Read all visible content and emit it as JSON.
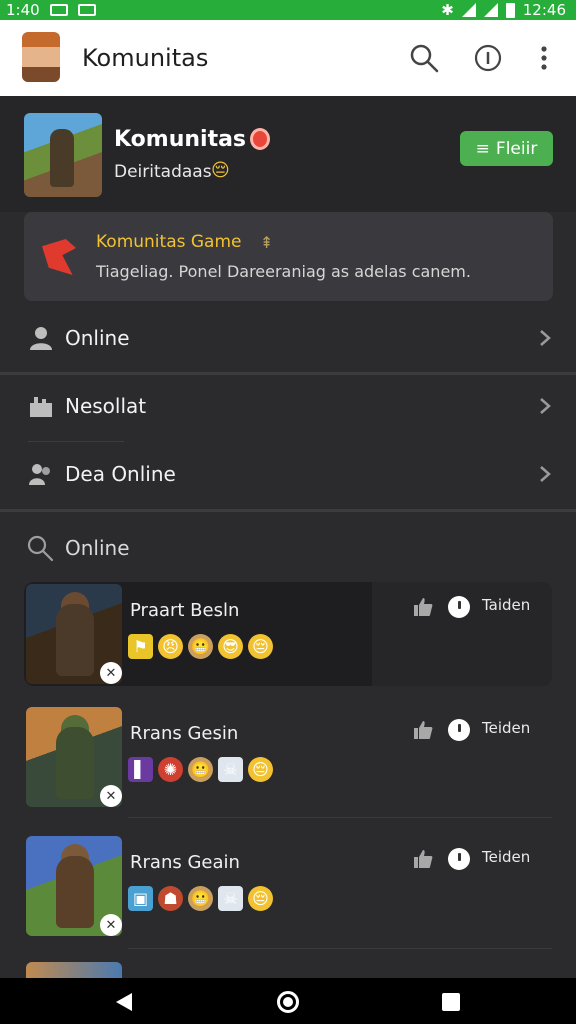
{
  "status_bar": {
    "time_left": "1:40",
    "time_right": "12:46"
  },
  "app_bar": {
    "title": "Komunitas"
  },
  "community": {
    "title": "Komunitas",
    "subtitle": "Deiritadaas",
    "join_label": "Fleiir"
  },
  "announcement": {
    "title": "Komunitas Game",
    "body": "Tiageliag. Ponel Dareeraniag as adelas canem."
  },
  "menu": {
    "online": "Online",
    "results": "Nesollat",
    "dea_online": "Dea Online"
  },
  "search": {
    "label": "Online"
  },
  "members": [
    {
      "name": "Praart Besln",
      "status": "Taiden"
    },
    {
      "name": "Rrans Gesin",
      "status": "Teiden"
    },
    {
      "name": "Rrans Geain",
      "status": "Teiden"
    }
  ],
  "colors": {
    "accent": "#4caf50",
    "status_bar": "#27ae3a",
    "announcement_title": "#f2c230"
  }
}
